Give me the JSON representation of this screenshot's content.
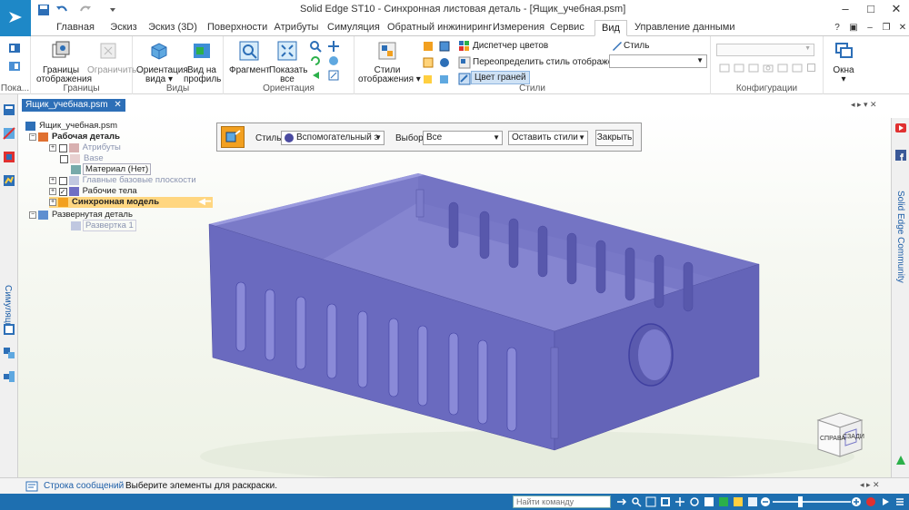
{
  "window": {
    "title": "Solid Edge ST10 - Синхронная листовая деталь - [Ящик_учебная.psm]",
    "minimize": "–",
    "maximize": "□",
    "close": "✕"
  },
  "tabs": [
    {
      "label": "Главная"
    },
    {
      "label": "Эскиз"
    },
    {
      "label": "Эскиз (3D)"
    },
    {
      "label": "Поверхности"
    },
    {
      "label": "Атрибуты"
    },
    {
      "label": "Симуляция"
    },
    {
      "label": "Обратный инжиниринг"
    },
    {
      "label": "Измерения"
    },
    {
      "label": "Сервис"
    },
    {
      "label": "Вид"
    },
    {
      "label": "Управление данными"
    }
  ],
  "active_tab": "Вид",
  "ribbon": {
    "pokaz_label": "Пока...",
    "groups": {
      "vidy_display": {
        "label": "Виды",
        "btn1": "Границы",
        "btn1b": "отображения",
        "btn2": "Ограничить"
      },
      "granitsy": {
        "label": "Границы"
      },
      "vidy": {
        "label": "Виды",
        "btn1": "Ориентация",
        "btn1b": "вида ▾",
        "btn2": "Вид на",
        "btn2b": "профиль"
      },
      "orientation": {
        "label": "Ориентация",
        "btn1": "Фрагмент",
        "btn2": "Показать",
        "btn2b": "все"
      },
      "styles": {
        "label": "Стили",
        "btn1": "Стили",
        "btn1b": "отображения ▾",
        "row1": "Диспетчер цветов",
        "row2": "Переопределить стиль отображения",
        "row3": "Цвет граней",
        "style_label": "Стиль"
      },
      "configs": {
        "label": "Конфигурации"
      },
      "window": {
        "btn1": "Окна",
        "btn1b": "▾"
      }
    }
  },
  "document_tab": {
    "label": "Ящик_учебная.psm",
    "close": "✕"
  },
  "left_strip": {
    "label": "Симуляция"
  },
  "right_strip": {
    "label": "Solid Edge Community"
  },
  "tree": {
    "root": "Ящик_учебная.psm",
    "work_part": "Рабочая деталь",
    "attributes": "Атрибуты",
    "base": "Base",
    "material": "Материал (Нет)",
    "planes": "Главные базовые плоскости",
    "bodies": "Рабочие тела",
    "sync_model": "Синхронная модель",
    "flat_part": "Развернутая деталь",
    "flat1": "Развертка 1"
  },
  "style_toolbar": {
    "style_label": "Стиль:",
    "style_value": "Вспомогательный э",
    "selection_label": "Выбор:",
    "selection_value": "Все",
    "keep_value": "Оставить стили",
    "close_label": "Закрыть"
  },
  "viewcube": {
    "front": "СПРАВА",
    "right": "СЗАДИ"
  },
  "status": {
    "label": "Строка сообщений",
    "message": "Выберите элементы для раскраски."
  },
  "command_search": {
    "placeholder": "Найти команду"
  },
  "colors": {
    "accent": "#1e88c7",
    "model_fill": "#6f6fc4",
    "status_bar": "#1e6fb0"
  }
}
